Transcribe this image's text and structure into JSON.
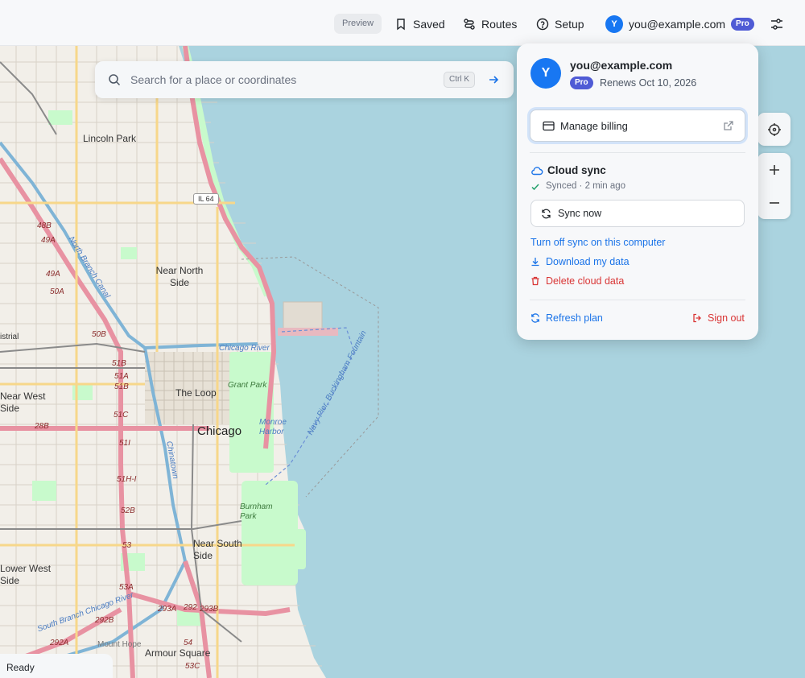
{
  "topbar": {
    "preview_badge": "Preview",
    "saved_label": "Saved",
    "routes_label": "Routes",
    "setup_label": "Setup",
    "account_initial": "Y",
    "account_email": "you@example.com",
    "account_badge": "Pro"
  },
  "search": {
    "placeholder": "Search for a place or coordinates",
    "value": "",
    "shortcut": "Ctrl K"
  },
  "map": {
    "neighborhoods": [
      "Lincoln Park",
      "Near North Side",
      "Near West Side",
      "The Loop",
      "Chicago",
      "Near South Side",
      "Lower West Side",
      "Armour Square"
    ],
    "route_shield": "IL 64",
    "parks": [
      "Grant Park",
      "Burnham Park",
      "Monroe Harbor"
    ],
    "water": [
      "Chicago River",
      "North Branch Canal",
      "Navy Pier, Buckingham Fountain",
      "South Branch Chicago River",
      "Chinatown"
    ],
    "exits": [
      "48B",
      "49A",
      "49A",
      "50A",
      "50B",
      "51B",
      "51A",
      "51B",
      "51C",
      "51I",
      "51H-I",
      "52B",
      "53",
      "53A",
      "292B",
      "292A",
      "293A",
      "292",
      "293B",
      "54",
      "53C"
    ],
    "misc": [
      "istrial",
      "Mount Hope",
      "28B"
    ]
  },
  "status": {
    "text": "Ready"
  },
  "popover": {
    "initial": "Y",
    "email": "you@example.com",
    "plan_badge": "Pro",
    "renews": "Renews Oct 10, 2026",
    "manage_billing": "Manage billing",
    "cloud_sync_title": "Cloud sync",
    "sync_status": "Synced · 2 min ago",
    "sync_now": "Sync now",
    "turn_off_sync": "Turn off sync on this computer",
    "download_data": "Download my data",
    "delete_data": "Delete cloud data",
    "refresh_plan": "Refresh plan",
    "sign_out": "Sign out"
  },
  "colors": {
    "accent": "#1877f2",
    "pro_badge": "#4f5bd5",
    "link": "#1a73e8",
    "danger": "#d93636",
    "water": "#aad3df",
    "land": "#f2efe9",
    "park": "#c8facc",
    "motorway": "#e892a2"
  },
  "icons": {
    "saved": "bookmark-icon",
    "routes": "route-icon",
    "setup": "help-circle-icon",
    "settings": "sliders-icon",
    "search": "search-icon",
    "go": "arrow-right-icon",
    "locate": "crosshair-icon",
    "zoom_in": "plus-icon",
    "zoom_out": "minus-icon"
  }
}
